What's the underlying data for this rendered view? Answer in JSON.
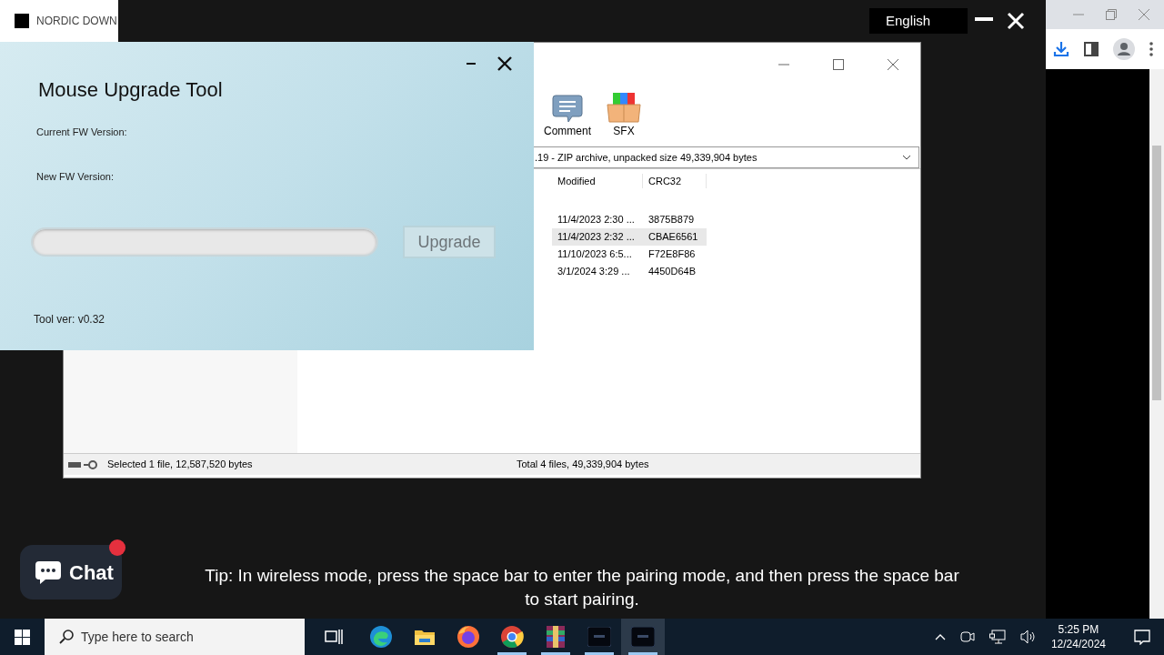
{
  "browser_tab": {
    "title": "NORDIC DOWN"
  },
  "app_overlay": {
    "language": "English"
  },
  "winrar": {
    "toolbar": [
      {
        "label": "Comment",
        "kind": "comment"
      },
      {
        "label": "SFX",
        "kind": "sfx"
      }
    ],
    "path": ".19 - ZIP archive, unpacked size 49,339,904 bytes",
    "columns": [
      "Modified",
      "CRC32"
    ],
    "rows": [
      {
        "modified": "11/4/2023 2:30 ...",
        "crc32": "3875B879",
        "selected": false
      },
      {
        "modified": "11/4/2023 2:32 ...",
        "crc32": "CBAE6561",
        "selected": true
      },
      {
        "modified": "11/10/2023 6:5...",
        "crc32": "F72E8F86",
        "selected": false
      },
      {
        "modified": "3/1/2024 3:29 ...",
        "crc32": "4450D64B",
        "selected": false
      }
    ],
    "status_left": "Selected 1 file, 12,587,520 bytes",
    "status_right": "Total 4 files, 49,339,904 bytes"
  },
  "upgrade_tool": {
    "title": "Mouse Upgrade Tool",
    "progress": {
      "level": 0
    },
    "fields": [
      {
        "label": "Current FW Version:"
      },
      {
        "label": "New FW Version:"
      }
    ],
    "button": "Upgrade",
    "version": "Tool ver: v0.32"
  },
  "tip": "Tip: In wireless mode, press the space bar to enter the pairing mode, and then press the space bar to start pairing.",
  "chat": {
    "label": "Chat"
  },
  "taskbar": {
    "search_placeholder": "Type here to search",
    "apps": [
      {
        "kind": "taskview",
        "running": false,
        "selected": false
      },
      {
        "kind": "edge",
        "running": false,
        "selected": false
      },
      {
        "kind": "explorer",
        "running": false,
        "selected": false
      },
      {
        "kind": "firefox",
        "running": false,
        "selected": false
      },
      {
        "kind": "chrome",
        "running": true,
        "selected": false
      },
      {
        "kind": "winrar",
        "running": true,
        "selected": false
      },
      {
        "kind": "app",
        "running": true,
        "selected": false
      },
      {
        "kind": "app",
        "running": true,
        "selected": true
      }
    ],
    "time": "5:25 PM",
    "date": "12/24/2024"
  }
}
